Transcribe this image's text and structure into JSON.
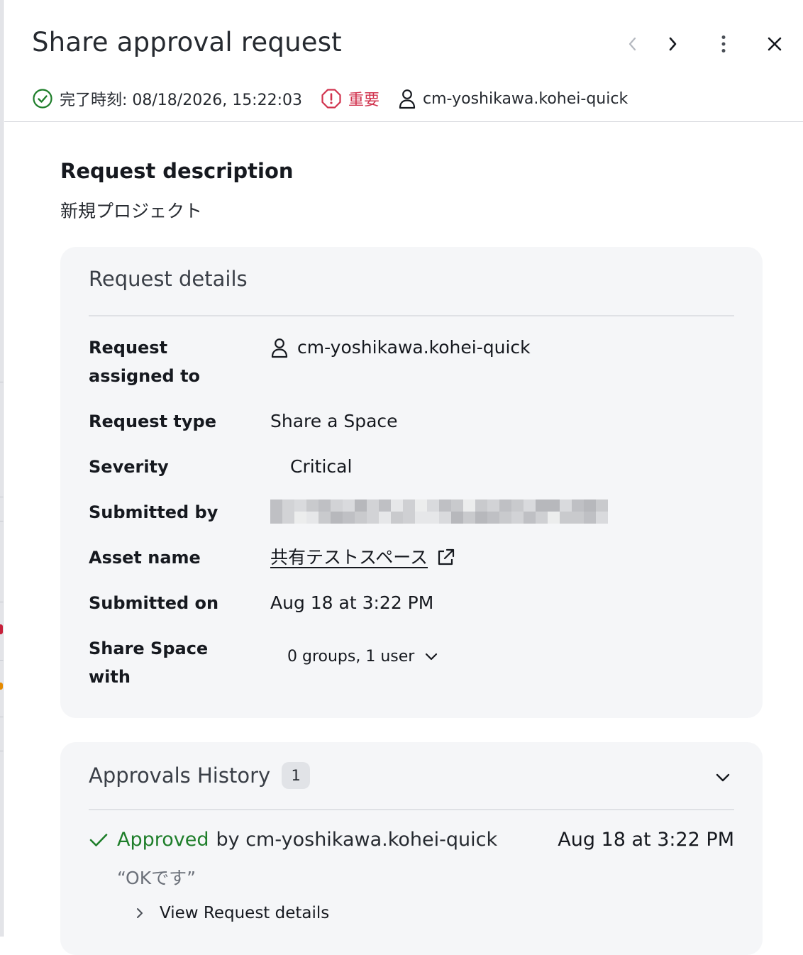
{
  "header": {
    "title": "Share approval request",
    "completed_text": "完了時刻: 08/18/2026, 15:22:03",
    "severity_text": "重要",
    "user_text": "cm-yoshikawa.kohei-quick"
  },
  "description": {
    "heading": "Request description",
    "body": "新規プロジェクト"
  },
  "details": {
    "heading": "Request details",
    "rows": {
      "assigned_to": {
        "label": "Request assigned to",
        "value": "cm-yoshikawa.kohei-quick"
      },
      "request_type": {
        "label": "Request type",
        "value": "Share a Space"
      },
      "severity": {
        "label": "Severity",
        "value": "Critical"
      },
      "submitted_by": {
        "label": "Submitted by"
      },
      "asset_name": {
        "label": "Asset name",
        "value": "共有テストスペース"
      },
      "submitted_on": {
        "label": "Submitted on",
        "value": "Aug 18 at 3:22 PM"
      },
      "share_with": {
        "label": "Share Space with",
        "value": "0 groups, 1 user"
      }
    }
  },
  "history": {
    "heading": "Approvals History",
    "count": "1",
    "entry": {
      "status": "Approved",
      "by": "by cm-yoshikawa.kohei-quick",
      "date": "Aug 18 at 3:22 PM",
      "comment": "“OKです”",
      "view_details": "View Request details"
    }
  },
  "colors": {
    "success": "#1e7e2a",
    "critical": "#d1334e",
    "card_bg": "#f5f6f8"
  }
}
